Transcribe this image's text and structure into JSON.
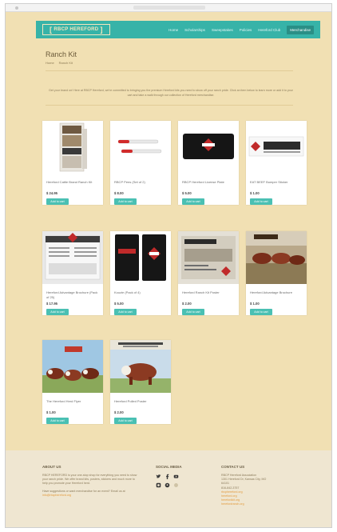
{
  "nav": {
    "logo": "RBCP HEREFORD",
    "links": [
      "Home",
      "Scholarships",
      "Sweepstakes",
      "Policies",
      "Hereford Club",
      "Merchandise"
    ],
    "active_index": 5
  },
  "page": {
    "title": "Ranch Kit",
    "breadcrumb": [
      "Home",
      "Ranch Kit"
    ],
    "intro": "Get your brand on! Here at RBCP Hereford, we're committed to bringing you the premium Hereford kits you need to show off your ranch pride. Click an item below to learn more or add it to your cart and take a walk through our collection of Hereford merchandise."
  },
  "products": [
    {
      "name": "Hereford Cattle Brand Ranch Kit",
      "price": "$ 24.95",
      "button": "Add to cart"
    },
    {
      "name": "RBCP Pens (Set of 2)",
      "price": "$ 8.00",
      "button": "Add to cart"
    },
    {
      "name": "RBCP Hereford License Plate",
      "price": "$ 5.00",
      "button": "Add to cart"
    },
    {
      "name": "EAT BEEF Bumper Sticker",
      "price": "$ 1.00",
      "button": "Add to cart"
    },
    {
      "name": "Hereford Advantage Brochure (Pack of 25)",
      "price": "$ 17.95",
      "button": "Add to cart"
    },
    {
      "name": "Koozie (Pack of 4)",
      "price": "$ 5.00",
      "button": "Add to cart"
    },
    {
      "name": "Hereford Ranch Kit Poster",
      "price": "$ 2.00",
      "button": "Add to cart"
    },
    {
      "name": "Hereford Advantage Brochure",
      "price": "$ 1.00",
      "button": "Add to cart"
    },
    {
      "name": "The Hereford Herd Flyer",
      "price": "$ 1.00",
      "button": "Add to cart"
    },
    {
      "name": "Hereford Polled Poster",
      "price": "$ 2.00",
      "button": "Add to cart"
    }
  ],
  "footer": {
    "about": {
      "heading": "ABOUT US",
      "text": "RBCP HEREFORD is your one-stop shop for everything you need to show your ranch pride. We offer brand kits, posters, stickers and much more to help you promote your Hereford herd.",
      "suggest": "Have suggestions or want merchandise for an event? Email us at",
      "email": "info@rbcphereford.org"
    },
    "social": {
      "heading": "SOCIAL MEDIA"
    },
    "contact": {
      "heading": "CONTACT US",
      "lines": [
        "RBCP Hereford Association",
        "1301 Hereford Dr, Kansas City, MO",
        "64101",
        "816-842-3757"
      ],
      "links": [
        "rbcphereford.org",
        "hereford.org",
        "herefordkit.org",
        "herefordranch.org"
      ]
    }
  }
}
